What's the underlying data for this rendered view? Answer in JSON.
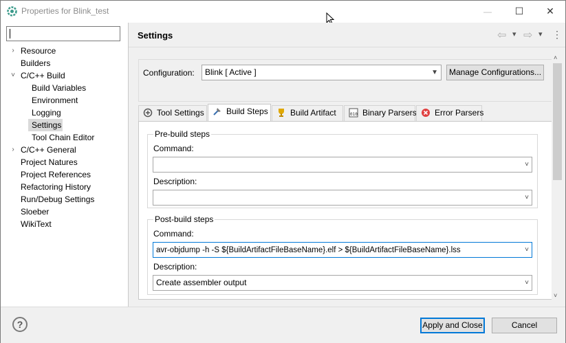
{
  "window": {
    "title": "Properties for Blink_test",
    "minimize_glyph": "—",
    "maximize_glyph": "☐",
    "close_glyph": "✕"
  },
  "filter": {
    "value": "",
    "placeholder": ""
  },
  "tree": [
    {
      "label": "Resource",
      "toggle": "›"
    },
    {
      "label": "Builders",
      "toggle": ""
    },
    {
      "label": "C/C++ Build",
      "toggle": "˅"
    },
    {
      "label": "Build Variables",
      "toggle": ""
    },
    {
      "label": "Environment",
      "toggle": ""
    },
    {
      "label": "Logging",
      "toggle": ""
    },
    {
      "label": "Settings",
      "toggle": "",
      "selected": true
    },
    {
      "label": "Tool Chain Editor",
      "toggle": ""
    },
    {
      "label": "C/C++ General",
      "toggle": "›"
    },
    {
      "label": "Project Natures",
      "toggle": ""
    },
    {
      "label": "Project References",
      "toggle": ""
    },
    {
      "label": "Refactoring History",
      "toggle": ""
    },
    {
      "label": "Run/Debug Settings",
      "toggle": ""
    },
    {
      "label": "Sloeber",
      "toggle": ""
    },
    {
      "label": "WikiText",
      "toggle": ""
    }
  ],
  "pane": {
    "title": "Settings",
    "nav_back": "⇦",
    "nav_forward": "⇨",
    "menu": "⋮",
    "dropdown": "▾"
  },
  "configuration": {
    "label": "Configuration:",
    "value": "Blink  [ Active ]",
    "manage_button": "Manage Configurations..."
  },
  "tabs": [
    {
      "label": "Tool Settings",
      "icon": "tool-settings-icon"
    },
    {
      "label": "Build Steps",
      "icon": "build-steps-icon",
      "active": true
    },
    {
      "label": "Build Artifact",
      "icon": "build-artifact-icon"
    },
    {
      "label": "Binary Parsers",
      "icon": "binary-parsers-icon"
    },
    {
      "label": "Error Parsers",
      "icon": "error-parsers-icon"
    }
  ],
  "pre_build": {
    "group_title": "Pre-build steps",
    "command_label": "Command:",
    "command_value": "",
    "description_label": "Description:",
    "description_value": ""
  },
  "post_build": {
    "group_title": "Post-build steps",
    "command_label": "Command:",
    "command_value": "avr-objdump -h -S ${BuildArtifactFileBaseName}.elf  > ${BuildArtifactFileBaseName}.lss",
    "description_label": "Description:",
    "description_value": "Create assembler output"
  },
  "footer": {
    "help_glyph": "?",
    "apply_close": "Apply and Close",
    "cancel": "Cancel"
  },
  "colors": {
    "accent_border": "#0078d7",
    "title_icon": "#3a9a8a"
  }
}
